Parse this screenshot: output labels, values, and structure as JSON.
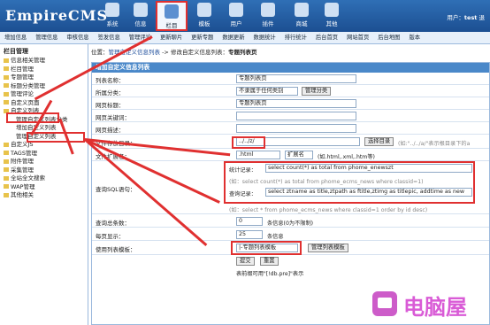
{
  "header": {
    "logo": "EmpireCMS",
    "tabs": [
      "系统",
      "信息",
      "栏目",
      "模板",
      "用户",
      "插件",
      "商城",
      "其他"
    ],
    "user_label": "用户：",
    "user_name": "test",
    "user_link": "退"
  },
  "subnav": [
    "增加信息",
    "管理信息",
    "审核信息",
    "签发信息",
    "管理评论",
    "更新聊片",
    "更新专题",
    "数据更新",
    "数据统计",
    "排行统计",
    "后台首页",
    "网站首页",
    "后台地图",
    "版本"
  ],
  "sidebar": {
    "title": "栏目管理",
    "items": [
      "信息相关管理",
      "栏目管理",
      "专题管理",
      "标题分类管理",
      "管理评论",
      "自定义页面",
      "自定义列表",
      "管理自定义列表分类",
      "增加自定义列表",
      "管理自定义列表",
      "自定义JS",
      "TAGS管理",
      "附件管理",
      "采集管理",
      "全站全文搜索",
      "WAP管理",
      "其他相关"
    ]
  },
  "breadcrumb": {
    "prefix": "位置：",
    "link1": "管理自定义信息列表",
    "sep": " -> ",
    "page": "修改自定义信息列表：",
    "current": "专题列表页"
  },
  "form": {
    "panel_title": "增加自定义信息列表",
    "list_name_label": "列表名称：",
    "list_name": "专题列表页",
    "category_label": "所属分类：",
    "category_value": "不隶属于任何类别",
    "category_button": "管理分类",
    "page_title_label": "网页标题：",
    "page_title": "专题列表页",
    "keywords_label": "网页关键词：",
    "description_label": "网页描述：",
    "file_dir_label": "文件存放目录：",
    "file_dir": "../../z/",
    "file_dir_button": "选择目录",
    "file_dir_hint": "(如:\"../../a/\"表示根目录下的a",
    "file_ext_label": "文件扩展名：",
    "file_ext": ".html",
    "file_ext_select": "扩展名",
    "file_ext_hint": "(如.html,.xml,.htm等)",
    "sql_label": "查询SQL语句：",
    "count_label": "统计记录：",
    "count_sql": "select count(*) as total from phome_enewszt",
    "count_example": "(如：select count(*) as total from phome_ecms_news where classid=1)",
    "query_label": "查询记录：",
    "query_sql": "select ztname as title,ztpath as ftitle,ztimg as titlepic, addtime as new",
    "query_example": "(如：select * from phome_ecms_news where classid=1 order by id desc)",
    "total_label": "查询总条数：",
    "total_value": "0",
    "total_hint": "条信息(0为不限制)",
    "perpage_label": "每页显示：",
    "perpage_value": "25",
    "perpage_hint": "条信息",
    "template_label": "使用列表模板：",
    "template_value": "|-专题列表模板",
    "template_button": "管理列表模板",
    "submit": "提交",
    "reset": "重置",
    "footer_note": "表前缀可用\"[!db.pre]\"表示"
  },
  "watermark": "电脑屋",
  "colors": {
    "accent": "#e03030",
    "header": "#2f6fb6",
    "panel_head": "#4a88c9"
  }
}
